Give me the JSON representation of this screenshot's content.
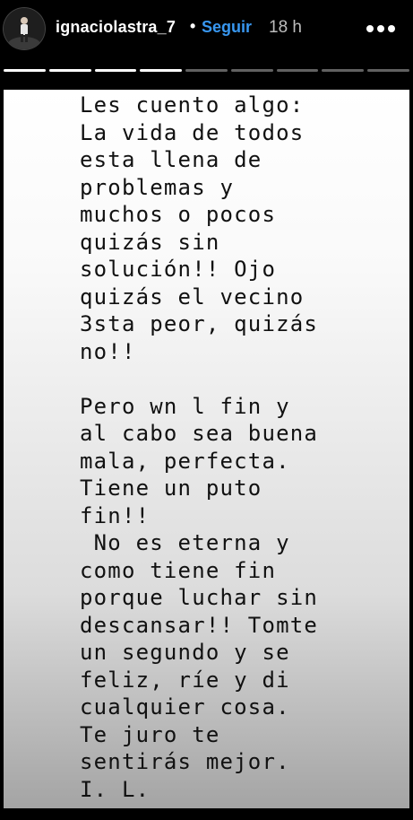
{
  "header": {
    "username": "ignaciolastra_7",
    "separator": "•",
    "follow_label": "Seguir",
    "time_ago": "18 h",
    "more_icon": "more-horizontal-icon"
  },
  "progress": {
    "total_segments": 9,
    "completed_segments": 4
  },
  "story": {
    "text": "Les cuento algo:\nLa vida de todos\nesta llena de\nproblemas y\nmuchos o pocos\nquizás sin\nsolución!! Ojo\nquizás el vecino\n3sta peor, quizás\nno!!\n\nPero wn l fin y\nal cabo sea buena\nmala, perfecta.\nTiene un puto\nfin!!\n No es eterna y\ncomo tiene fin\nporque luchar sin\ndescansar!! Tomte\nun segundo y se\nfeliz, ríe y di\ncualquier cosa.\nTe juro te\nsentirás mejor.\nI. L."
  },
  "colors": {
    "background": "#000000",
    "follow": "#3897f0",
    "progress_done": "#ffffff",
    "progress_pending": "rgba(255,255,255,0.38)",
    "text": "#111111"
  }
}
